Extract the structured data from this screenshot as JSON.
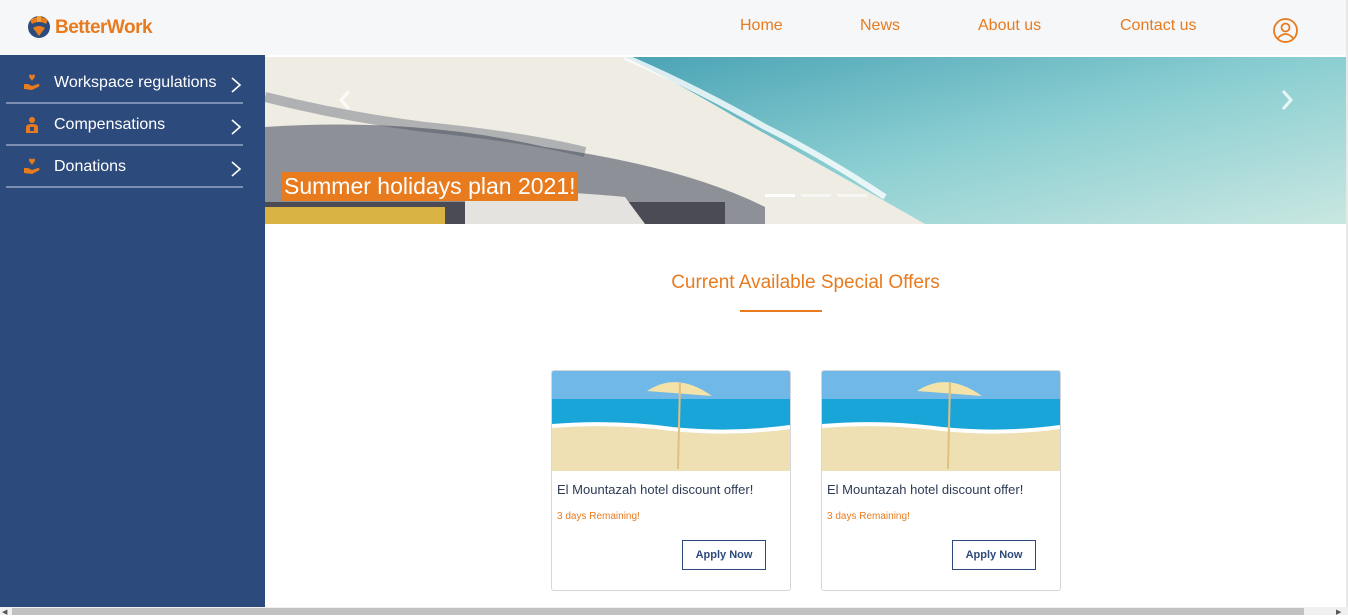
{
  "header": {
    "logo_text": "BetterWork",
    "nav": [
      {
        "label": "Home"
      },
      {
        "label": "News"
      },
      {
        "label": "About us"
      },
      {
        "label": "Contact us"
      }
    ],
    "user_icon": "user-circle-icon"
  },
  "sidebar": {
    "items": [
      {
        "label": "Workspace regulations",
        "icon": "hand-heart-icon"
      },
      {
        "label": "Compensations",
        "icon": "person-money-icon"
      },
      {
        "label": "Donations",
        "icon": "hand-heart-icon"
      }
    ]
  },
  "hero": {
    "caption": "Summer holidays plan 2021!",
    "slide_count": 3,
    "active_slide": 1
  },
  "offers": {
    "title": "Current Available Special Offers",
    "cards": [
      {
        "title": "El Mountazah hotel discount offer!",
        "remaining": "3 days Remaining!",
        "button": "Apply Now"
      },
      {
        "title": "El Mountazah hotel discount offer!",
        "remaining": "3 days Remaining!",
        "button": "Apply Now"
      }
    ]
  },
  "colors": {
    "accent": "#e87b1e",
    "sidebar": "#2d4a7c",
    "header_bg": "#f6f7f9"
  }
}
